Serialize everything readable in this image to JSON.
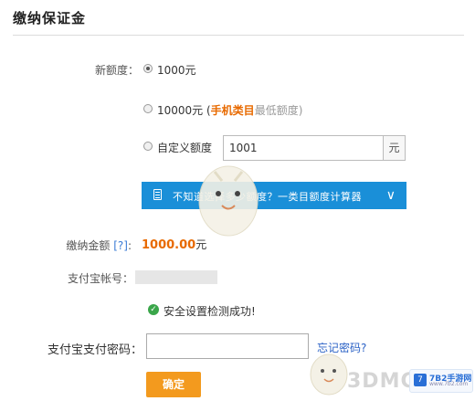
{
  "header": {
    "title": "缴纳保证金"
  },
  "deposit": {
    "label": "新额度：",
    "options": [
      {
        "text": "1000元",
        "selected": true
      },
      {
        "text": "10000元 (",
        "highlight": "手机类目",
        "suffix": "最低额度)",
        "selected": false
      },
      {
        "text": "自定义额度",
        "selected": false
      }
    ],
    "custom_value": "1001",
    "custom_unit": "元"
  },
  "info_bar": {
    "text": "不知道选择多少额度？一类目额度计算器",
    "icon": "document-icon",
    "chevron": "chevron-down-icon",
    "color": "#1a8fd8"
  },
  "total": {
    "label": "缴纳金额",
    "help": "[?]",
    "colon": ":",
    "amount": "1000.00",
    "unit": "元"
  },
  "alipay": {
    "account_label": "支付宝帐号：",
    "security_ok": "安全设置检测成功!",
    "password_label": "支付宝支付密码：",
    "forgot": "忘记密码?"
  },
  "confirm_button": "确定",
  "watermark": {
    "brand": "3DMG",
    "logo_top": "7B2手游网",
    "logo_bottom": "www.7b2.com"
  },
  "colors": {
    "accent": "#f39a1e",
    "amount": "#e86a00",
    "link": "#2b62c6"
  }
}
